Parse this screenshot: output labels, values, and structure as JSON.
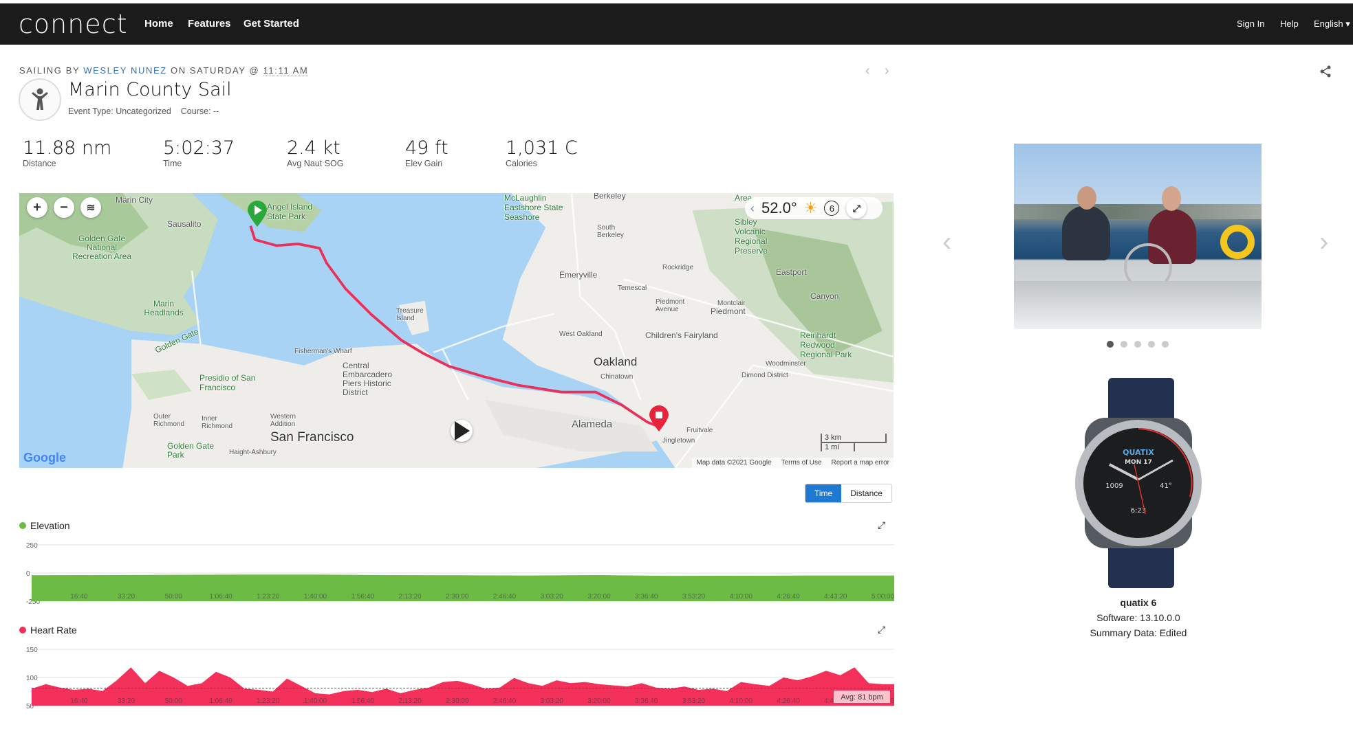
{
  "header": {
    "logo": "connect",
    "nav": [
      "Home",
      "Features",
      "Get Started"
    ],
    "right": [
      "Sign In",
      "Help",
      "English ▾"
    ]
  },
  "activity": {
    "type_prefix": "SAILING BY ",
    "user": "WESLEY NUNEZ",
    "day": " ON SATURDAY @ ",
    "time": "11:11 AM",
    "title": "Marin County Sail",
    "event_type": "Event Type: Uncategorized",
    "course": "Course: --",
    "icon": "person-icon"
  },
  "stats": [
    {
      "value": "11.88 nm",
      "label": "Distance"
    },
    {
      "value": "5:02:37",
      "label": "Time"
    },
    {
      "value": "2.4 kt",
      "label": "Avg Naut SOG"
    },
    {
      "value": "49 ft",
      "label": "Elev Gain"
    },
    {
      "value": "1,031 C",
      "label": "Calories"
    }
  ],
  "map": {
    "temperature": "52.0°",
    "wind": "6",
    "attribution": [
      "Map data ©2021 Google",
      "Terms of Use",
      "Report a map error"
    ],
    "scale": [
      "3 km",
      "1 mi"
    ],
    "brand": "Google",
    "route_color": "#e8305a",
    "labels": [
      "Marin City",
      "Sausalito",
      "Golden Gate National Recreation Area",
      "Marin Headlands",
      "Golden Gate",
      "Angel Island State Park",
      "Presidio of San Francisco",
      "San Francisco",
      "Fisherman's Wharf",
      "Central Embarcadero Piers Historic District",
      "Treasure Island",
      "Emeryville",
      "Berkeley",
      "McLaughlin Eastshore State Seashore",
      "South Berkeley",
      "Rockridge",
      "Temescal",
      "Piedmont Avenue",
      "Piedmont",
      "West Oakland",
      "Oakland",
      "Chinatown",
      "Alameda",
      "Fruitvale",
      "Jingletown",
      "Children's Fairyland",
      "Sibley Volcanic Regional Preserve",
      "Montclair",
      "Reinhardt Redwood Regional Park",
      "Dimond District",
      "Woodminster",
      "Eastport",
      "Canyon",
      "Outer Richmond",
      "Inner Richmond",
      "Western Addition",
      "Golden Gate Park",
      "Haight-Ashbury",
      "Area"
    ]
  },
  "toggle": {
    "options": [
      "Time",
      "Distance"
    ],
    "selected": "Time"
  },
  "chart_data": [
    {
      "type": "area",
      "title": "Elevation",
      "color": "#6cbb45",
      "ylim": [
        -250,
        250
      ],
      "yticks": [
        250,
        0,
        -250
      ],
      "xticks": [
        "16:40",
        "33:20",
        "50:00",
        "1:06:40",
        "1:23:20",
        "1:40:00",
        "1:56:40",
        "2:13:20",
        "2:30:00",
        "2:46:40",
        "3:03:20",
        "3:20:00",
        "3:36:40",
        "3:53:20",
        "4:10:00",
        "4:26:40",
        "4:43:20",
        "5:00:00"
      ],
      "x_minutes": [
        0,
        25,
        50,
        75,
        100,
        125,
        150,
        175,
        200,
        225,
        250,
        275,
        300
      ],
      "values": [
        -20,
        -18,
        -16,
        -14,
        -14,
        -18,
        -20,
        -22,
        -18,
        -25,
        -24,
        -22,
        -22
      ]
    },
    {
      "type": "area",
      "title": "Heart Rate",
      "color": "#f2305a",
      "ylim": [
        50,
        150
      ],
      "yticks": [
        150,
        100,
        50
      ],
      "average_label": "Avg: 81 bpm",
      "average": 81,
      "xticks": [
        "16:40",
        "33:20",
        "50:00",
        "1:06:40",
        "1:23:20",
        "1:40:00",
        "1:56:40",
        "2:13:20",
        "2:30:00",
        "2:46:40",
        "3:03:20",
        "3:20:00",
        "3:36:40",
        "3:53:20",
        "4:10:00",
        "4:26:40",
        "4:43:20",
        "5:00:00"
      ],
      "x_minutes": [
        0,
        5,
        10,
        15,
        20,
        25,
        30,
        35,
        40,
        45,
        50,
        55,
        60,
        65,
        70,
        75,
        80,
        85,
        90,
        95,
        100,
        105,
        110,
        115,
        120,
        125,
        130,
        135,
        140,
        145,
        150,
        155,
        160,
        165,
        170,
        175,
        180,
        185,
        190,
        195,
        200,
        205,
        210,
        215,
        220,
        225,
        230,
        235,
        240,
        245,
        250,
        255,
        260,
        265,
        270,
        275,
        280,
        285,
        290,
        295,
        300
      ],
      "values": [
        80,
        88,
        82,
        78,
        80,
        76,
        95,
        118,
        90,
        112,
        100,
        85,
        90,
        110,
        100,
        80,
        78,
        75,
        98,
        85,
        72,
        70,
        76,
        78,
        74,
        80,
        72,
        78,
        82,
        92,
        94,
        88,
        80,
        82,
        99,
        90,
        85,
        95,
        90,
        92,
        88,
        86,
        84,
        90,
        82,
        80,
        84,
        78,
        80,
        76,
        92,
        88,
        85,
        100,
        95,
        102,
        112,
        104,
        118,
        90,
        88
      ]
    }
  ],
  "device": {
    "name": "quatix 6",
    "software": "Software: 13.10.0.0",
    "summary": "Summary Data: Edited",
    "watch_text": [
      "QUATIX",
      "MON 17",
      "1009",
      "41°",
      "6:23"
    ]
  }
}
